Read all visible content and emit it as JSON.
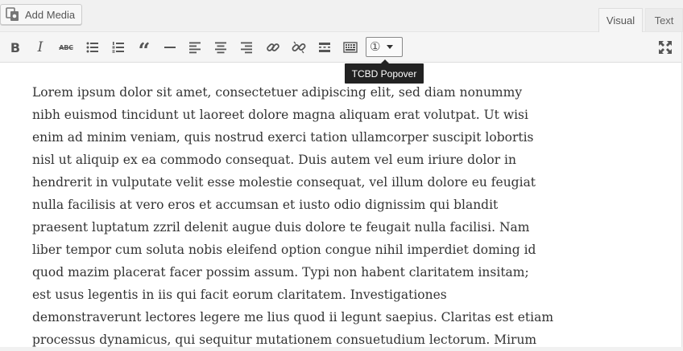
{
  "header": {
    "add_media_label": "Add Media",
    "tabs": [
      {
        "label": "Visual",
        "active": true
      },
      {
        "label": "Text",
        "active": false
      }
    ]
  },
  "toolbar": {
    "buttons": [
      {
        "name": "bold",
        "glyph": "B"
      },
      {
        "name": "italic",
        "glyph": "I"
      },
      {
        "name": "strikethrough",
        "glyph": "ABC"
      },
      {
        "name": "bulleted-list",
        "icon": "bullet-list-icon"
      },
      {
        "name": "numbered-list",
        "icon": "numbered-list-icon"
      },
      {
        "name": "blockquote",
        "glyph": "“"
      },
      {
        "name": "horizontal-line",
        "icon": "horizontal-line-icon"
      },
      {
        "name": "align-left",
        "icon": "align-left-icon"
      },
      {
        "name": "align-center",
        "icon": "align-center-icon"
      },
      {
        "name": "align-right",
        "icon": "align-right-icon"
      },
      {
        "name": "insert-link",
        "icon": "link-icon"
      },
      {
        "name": "remove-link",
        "icon": "unlink-icon"
      },
      {
        "name": "read-more",
        "icon": "read-more-icon"
      },
      {
        "name": "toolbar-toggle",
        "icon": "keyboard-icon"
      }
    ],
    "tcbd_select_glyph": "①",
    "tooltip_text": "TCBD Popover",
    "fullscreen_icon": "fullscreen-icon"
  },
  "content": {
    "lines": [
      "Lorem ipsum dolor sit amet, consectetuer adipiscing elit, sed diam nonummy",
      "nibh euismod tincidunt ut laoreet dolore magna aliquam erat volutpat. Ut wisi",
      "enim ad minim veniam, quis nostrud exerci tation ullamcorper suscipit lobortis",
      "nisl ut aliquip ex ea commodo consequat. Duis autem vel eum iriure dolor in",
      "hendrerit in vulputate velit esse molestie consequat, vel illum dolore eu feugiat",
      "nulla facilisis at vero eros et accumsan et iusto odio dignissim qui blandit",
      "praesent luptatum zzril delenit augue duis dolore te feugait nulla facilisi. Nam",
      "liber tempor cum soluta nobis eleifend option congue nihil imperdiet doming id",
      "quod mazim placerat facer possim assum. Typi non habent claritatem insitam;",
      "est usus legentis in iis qui facit eorum claritatem. Investigationes",
      "demonstraverunt lectores legere me lius quod ii legunt saepius. Claritas est etiam",
      "processus dynamicus, qui sequitur mutationem consuetudium lectorum. Mirum"
    ]
  }
}
